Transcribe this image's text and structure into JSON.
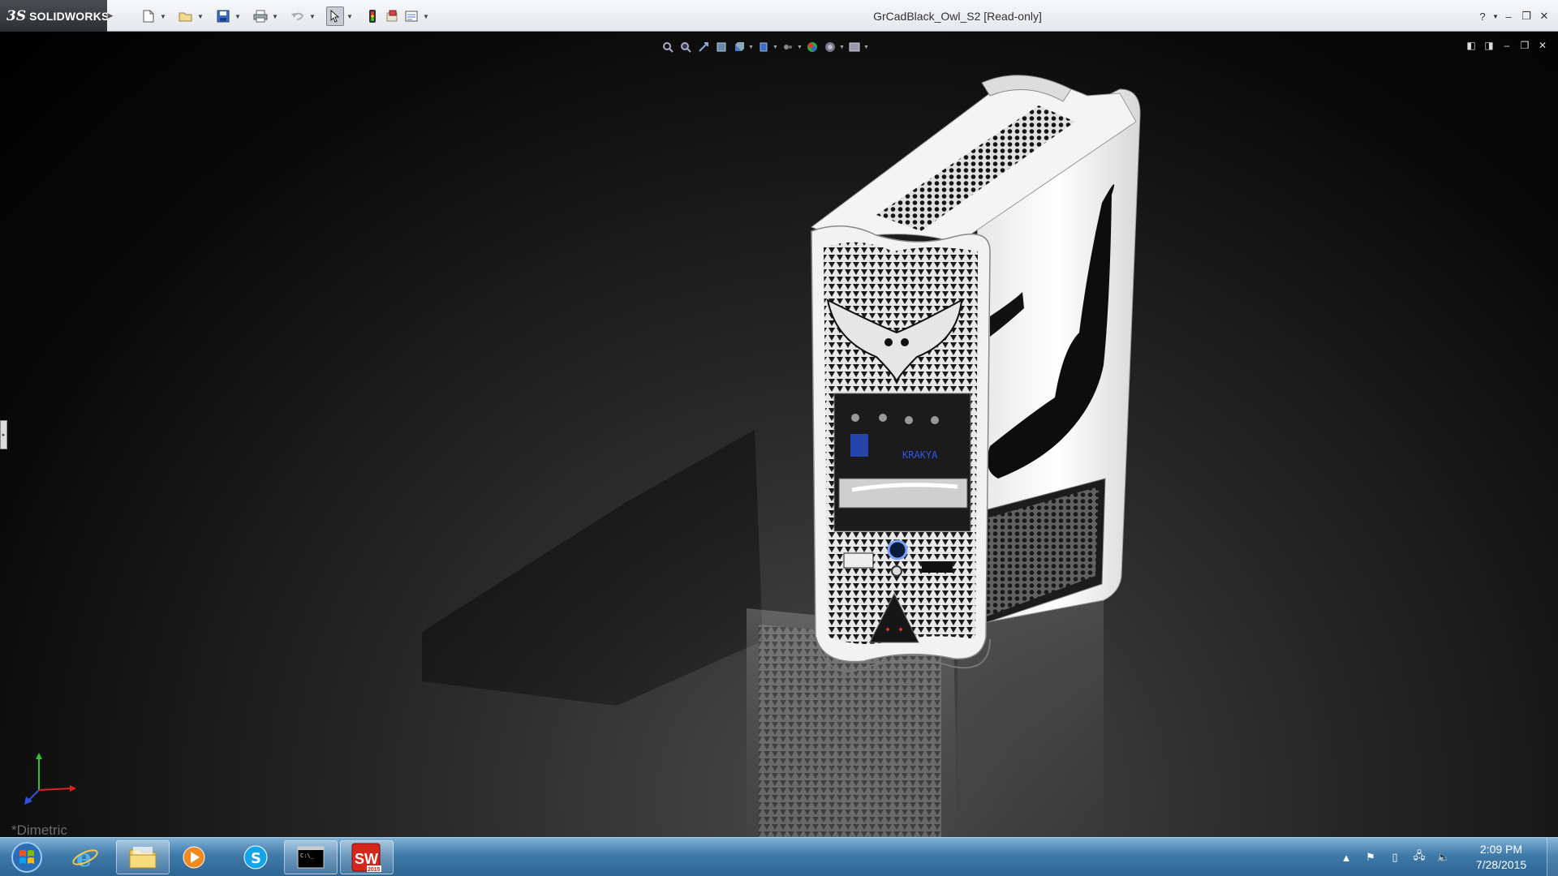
{
  "app": {
    "brand_prefix": "3S",
    "brand_name": "SOLIDWORKS",
    "window_title": "GrCadBlack_Owl_S2 [Read-only]"
  },
  "quick_access": [
    "new-document-icon",
    "open-icon",
    "save-icon",
    "print-icon",
    "undo-icon",
    "select-icon",
    "rebuild-icon",
    "file-properties-icon",
    "options-icon"
  ],
  "heads_up_toolbar": [
    "zoom-to-fit-icon",
    "zoom-to-area-icon",
    "previous-view-icon",
    "section-view-icon",
    "view-orientation-icon",
    "display-style-icon",
    "hide-show-items-icon",
    "edit-appearance-icon",
    "apply-scene-icon",
    "view-settings-icon"
  ],
  "viewport": {
    "view_name": "*Dimetric",
    "model_emblem_text": "KRAKYA"
  },
  "taskbar": {
    "apps": [
      "start-orb",
      "internet-explorer",
      "file-explorer",
      "media-player",
      "skype",
      "command-prompt",
      "solidworks-2015"
    ],
    "solidworks_badge": "2015",
    "time": "2:09 PM",
    "date": "7/28/2015"
  },
  "colors": {
    "title_bar": "#e9ecf0",
    "brand_bg": "#3a3c40",
    "viewport_bg": "#101010",
    "taskbar": "#3f7aa9",
    "solidworks_red": "#d5261c"
  }
}
